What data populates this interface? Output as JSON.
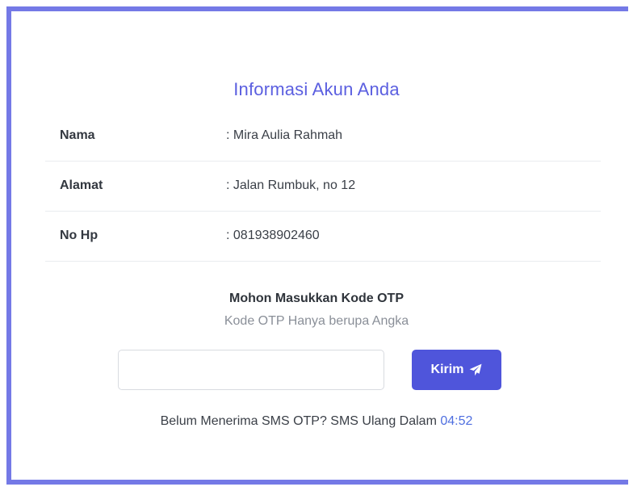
{
  "card": {
    "title": "Informasi Akun Anda"
  },
  "account": {
    "rows": [
      {
        "label": "Nama",
        "value": ": Mira Aulia Rahmah"
      },
      {
        "label": "Alamat",
        "value": ": Jalan Rumbuk, no 12"
      },
      {
        "label": "No Hp",
        "value": ": 081938902460"
      }
    ]
  },
  "otp": {
    "heading": "Mohon Masukkan Kode OTP",
    "hint": "Kode OTP Hanya berupa Angka",
    "input_value": "",
    "input_placeholder": "",
    "submit_label": "Kirim",
    "submit_icon": "paper-plane-icon",
    "resend_text": "Belum Menerima SMS OTP? SMS Ulang Dalam ",
    "countdown": "04:52"
  },
  "colors": {
    "accent": "#5b5fe0",
    "button": "#4f55db",
    "countdown": "#4f6fe0",
    "frame_border": "#7479e6"
  }
}
